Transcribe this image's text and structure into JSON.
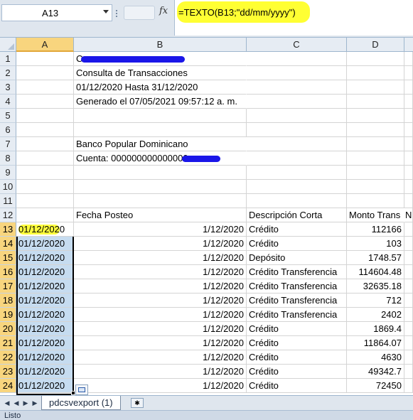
{
  "formula_bar": {
    "cell_reference": "A13",
    "fx_label": "fx",
    "formula": "=TEXTO(B13;\"dd/mm/yyyy\")"
  },
  "columns": [
    "A",
    "B",
    "C",
    "D"
  ],
  "rows": {
    "r1": "1",
    "r2": "2",
    "r3": "3",
    "r4": "4",
    "r5": "5",
    "r6": "6",
    "r7": "7",
    "r8": "8",
    "r9": "9",
    "r10": "10",
    "r11": "11",
    "r12": "12",
    "r13": "13",
    "r14": "14",
    "r15": "15",
    "r16": "16",
    "r17": "17",
    "r18": "18",
    "r19": "19",
    "r20": "20",
    "r21": "21",
    "r22": "22",
    "r23": "23",
    "r24": "24"
  },
  "header_block": {
    "line1": "C",
    "line2": "Consulta de Transacciones",
    "line3": "01/12/2020 Hasta 31/12/2020",
    "line4": "Generado el 07/05/2021 09:57:12 a. m.",
    "bank": "Banco Popular Dominicano",
    "account": "Cuenta: 000000000000000"
  },
  "table_headers": {
    "b": "Fecha Posteo",
    "c": "Descripción Corta",
    "d": "Monto Trans",
    "e": "N"
  },
  "data_rows": [
    {
      "a": "01/12/2020",
      "b": "1/12/2020",
      "c": "Crédito",
      "d": "112166"
    },
    {
      "a": "01/12/2020",
      "b": "1/12/2020",
      "c": "Crédito",
      "d": "103"
    },
    {
      "a": "01/12/2020",
      "b": "1/12/2020",
      "c": "Depósito",
      "d": "1748.57"
    },
    {
      "a": "01/12/2020",
      "b": "1/12/2020",
      "c": "Crédito Transferencia",
      "d": "114604.48"
    },
    {
      "a": "01/12/2020",
      "b": "1/12/2020",
      "c": "Crédito Transferencia",
      "d": "32635.18"
    },
    {
      "a": "01/12/2020",
      "b": "1/12/2020",
      "c": "Crédito Transferencia",
      "d": "712"
    },
    {
      "a": "01/12/2020",
      "b": "1/12/2020",
      "c": "Crédito Transferencia",
      "d": "2402"
    },
    {
      "a": "01/12/2020",
      "b": "1/12/2020",
      "c": "Crédito",
      "d": "1869.4"
    },
    {
      "a": "01/12/2020",
      "b": "1/12/2020",
      "c": "Crédito",
      "d": "11864.07"
    },
    {
      "a": "01/12/2020",
      "b": "1/12/2020",
      "c": "Crédito",
      "d": "4630"
    },
    {
      "a": "01/12/2020",
      "b": "1/12/2020",
      "c": "Crédito",
      "d": "49342.7"
    },
    {
      "a": "01/12/2020",
      "b": "1/12/2020",
      "c": "Crédito",
      "d": "72450"
    }
  ],
  "sheet_tabs": {
    "active": "pdcsvexport (1)"
  },
  "status": {
    "text": "Listo"
  },
  "colors": {
    "selection": "#c6dcf0",
    "highlight": "#ffff33",
    "redaction": "#1a16e8",
    "header_bg": "#e6ecf3",
    "active_header": "#f8d57e"
  }
}
